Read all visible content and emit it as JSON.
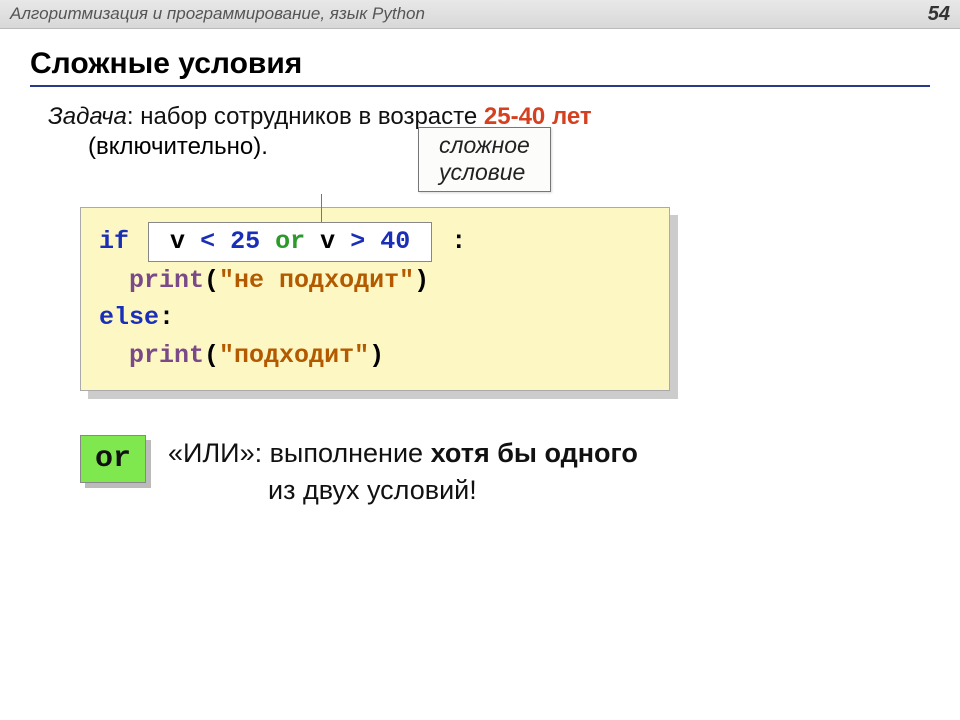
{
  "header": {
    "title": "Алгоритмизация и программирование, язык Python",
    "page": "54"
  },
  "section_title": "Сложные условия",
  "task": {
    "label": "Задача",
    "text1": ": набор сотрудников в возрасте ",
    "accent": "25-40 лет",
    "text2": "(включительно).",
    "callout_line1": "сложное",
    "callout_line2": "условие"
  },
  "code": {
    "if_kw": "if",
    "cond_v1": "v",
    "cond_lt": "<",
    "cond_n1": "25",
    "cond_or": "or",
    "cond_v2": "v",
    "cond_gt": ">",
    "cond_n2": "40",
    "colon": ":",
    "print_fn": "print",
    "str1": "\"не подходит\"",
    "else_kw": "else",
    "str2": "\"подходит\""
  },
  "or_section": {
    "badge": "or",
    "prefix": "«ИЛИ»: выполнение ",
    "bold": "хотя бы одного",
    "line2": "из двух условий!"
  }
}
